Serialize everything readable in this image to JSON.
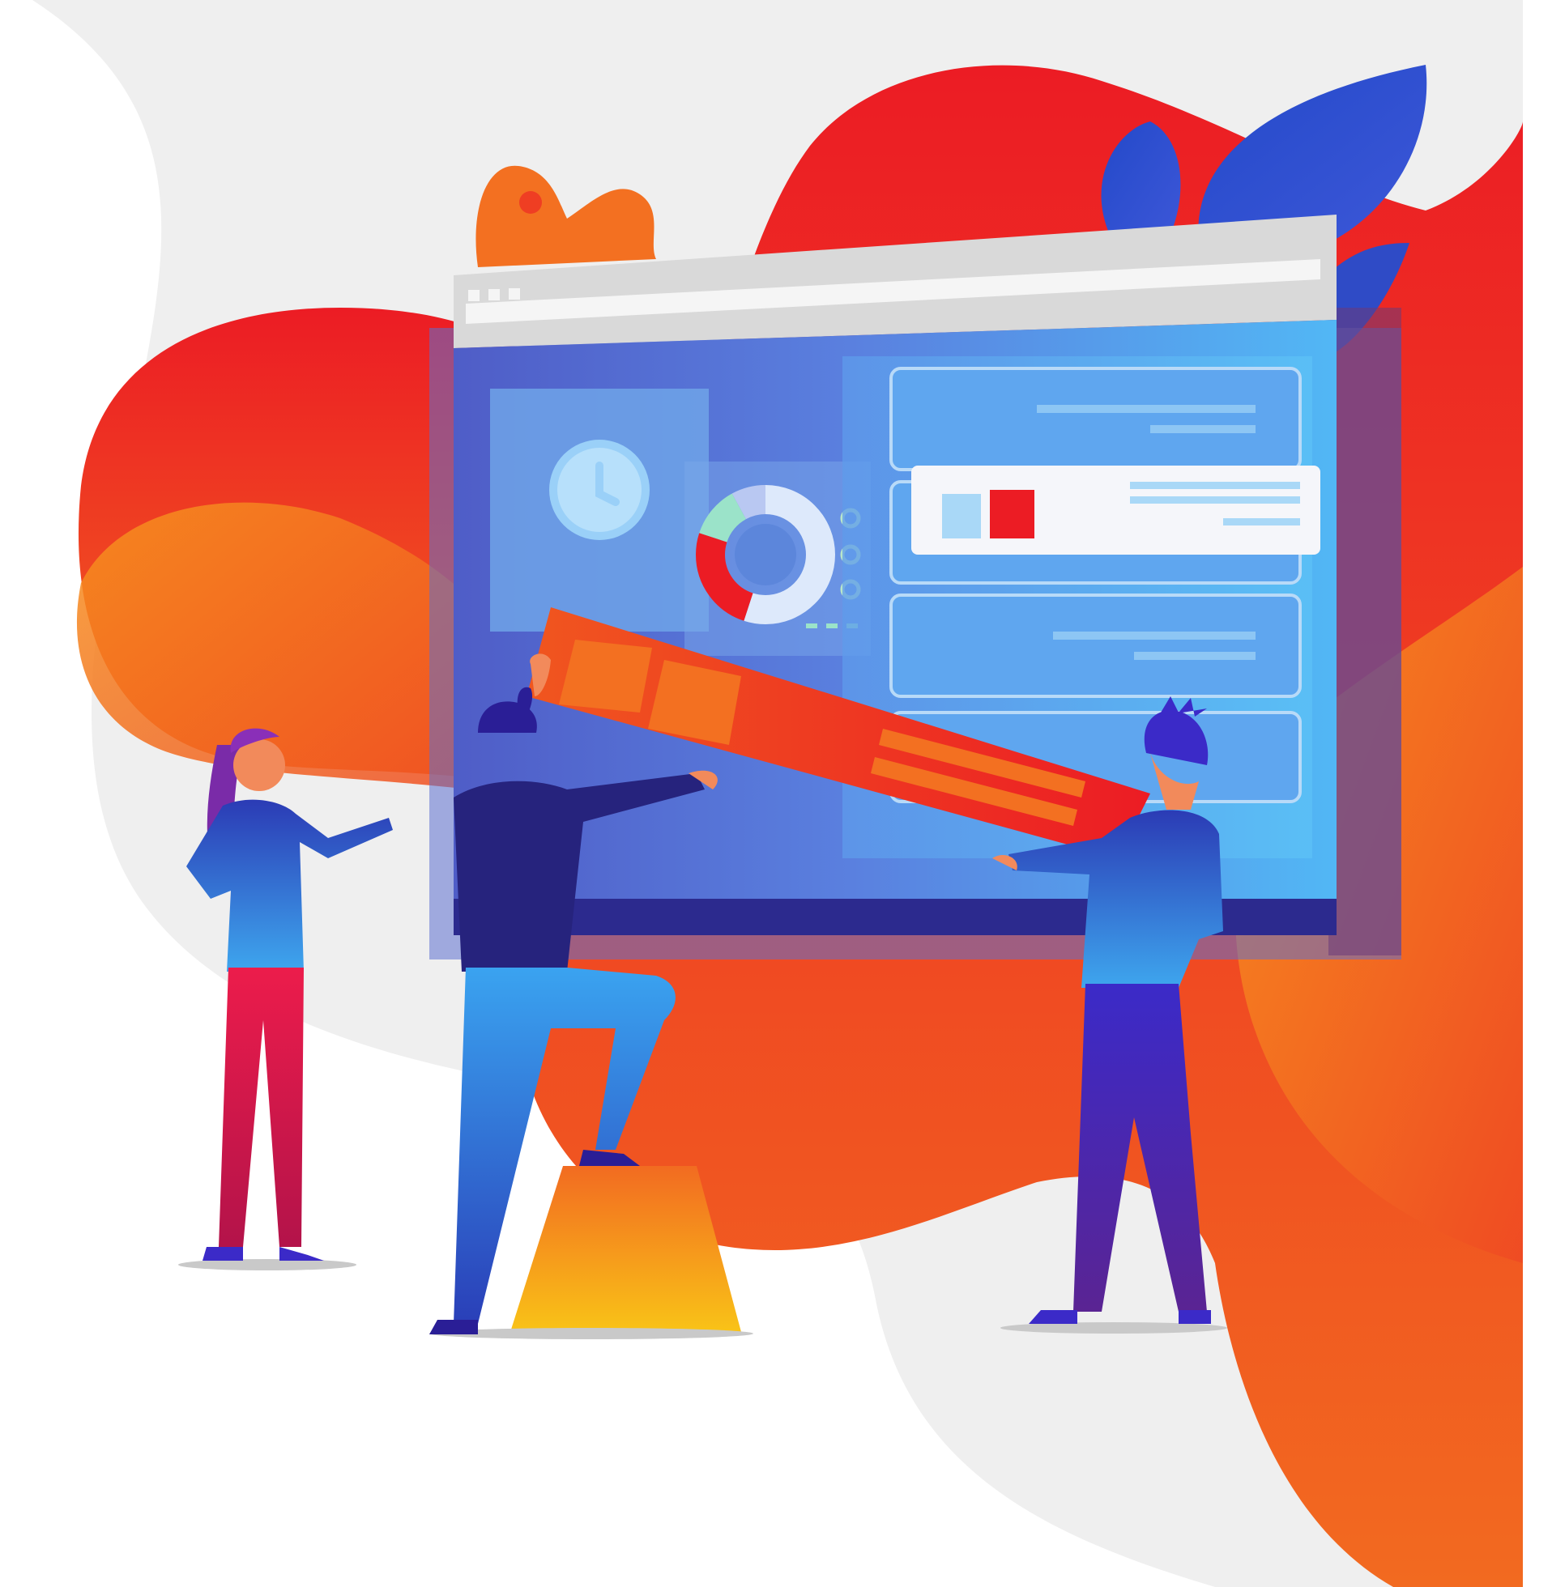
{
  "illustration": {
    "subject": "team-building-web-dashboard",
    "palette": {
      "background_grey": "#EFEFEF",
      "blob_red": "#EC1C24",
      "blob_orange": "#F47A20",
      "screen_blue": "#4FA3EE",
      "screen_indigo": "#4D5FC8",
      "leaf_blue": "#2F4BC6",
      "pedestal_yellow": "#F7B21B"
    },
    "icons": [
      "browser-window-icon",
      "clock-icon",
      "donut-chart-icon",
      "card-element-icon",
      "leaf-icon",
      "person-icon",
      "pedestal-icon"
    ],
    "donut_chart": {
      "segments": [
        {
          "color": "#DDE9FB",
          "fraction": 0.55
        },
        {
          "color": "#EC1C24",
          "fraction": 0.25
        },
        {
          "color": "#9BE3C9",
          "fraction": 0.12
        },
        {
          "color": "#B9C8F2",
          "fraction": 0.08
        }
      ]
    }
  }
}
